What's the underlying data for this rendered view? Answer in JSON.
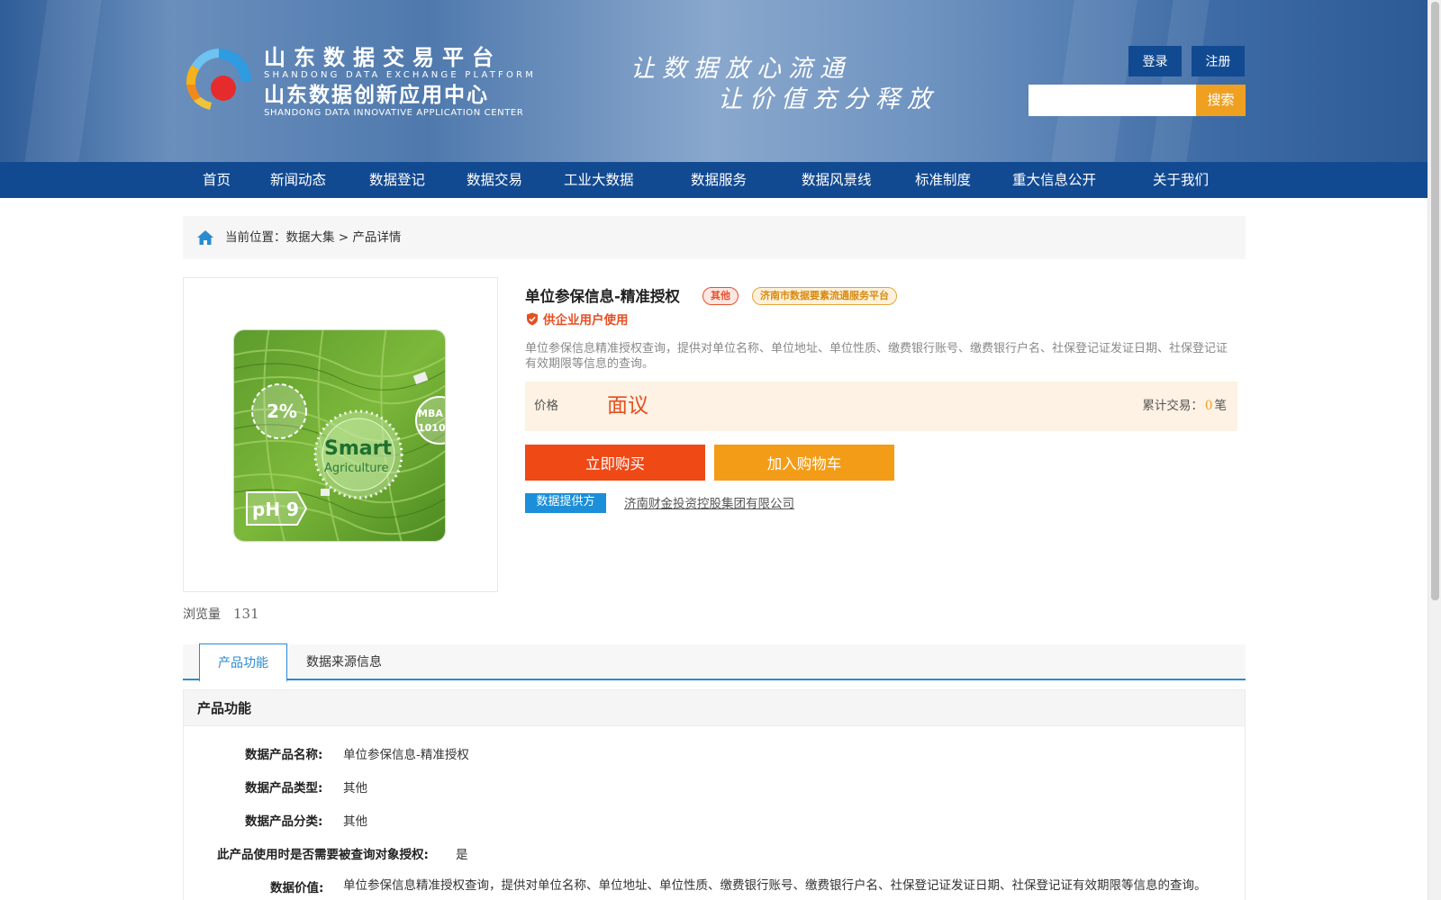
{
  "header": {
    "brand_cn1": "山东数据交易平台",
    "brand_en1": "SHANDONG DATA EXCHANGE PLATFORM",
    "brand_cn2": "山东数据创新应用中心",
    "brand_en2": "SHANDONG DATA INNOVATIVE APPLICATION CENTER",
    "slogan1": "让数据放心流通",
    "slogan2": "让价值充分释放",
    "login_label": "登录",
    "register_label": "注册",
    "search_placeholder": "",
    "search_label": "搜索"
  },
  "nav": {
    "items": [
      {
        "label": "首页"
      },
      {
        "label": "新闻动态"
      },
      {
        "label": "数据登记"
      },
      {
        "label": "数据交易"
      },
      {
        "label": "工业大数据"
      },
      {
        "label": "数据服务"
      },
      {
        "label": "数据风景线"
      },
      {
        "label": "标准制度"
      },
      {
        "label": "重大信息公开"
      },
      {
        "label": "关于我们"
      }
    ]
  },
  "breadcrumb": {
    "prefix": "当前位置：",
    "level1": "数据大集",
    "separator": " > ",
    "level2": "产品详情"
  },
  "product": {
    "title": "单位参保信息-精准授权",
    "tag_type": "其他",
    "tag_platform": "济南市数据要素流通服务平台",
    "enterprise_note": "供企业用户使用",
    "description": "单位参保信息精准授权查询，提供对单位名称、单位地址、单位性质、缴费银行账号、缴费银行户名、社保登记证发证日期、社保登记证有效期限等信息的查询。",
    "price_label": "价格",
    "price_value": "面议",
    "trade_label": "累计交易：",
    "trade_count": "0",
    "trade_unit": "笔",
    "buy_label": "立即购买",
    "cart_label": "加入购物车",
    "provider_badge": "数据提供方",
    "provider_name": "济南财金投资控股集团有限公司",
    "views_label": "浏览量",
    "views_count": "131",
    "image_text_pct": "2%",
    "image_text_smart": "Smart",
    "image_text_agri": "Agriculture",
    "image_text_ph": "pH 9",
    "image_text_mba": "MBA",
    "image_text_num": "1010"
  },
  "tabs": [
    {
      "label": "产品功能",
      "active": true
    },
    {
      "label": "数据来源信息",
      "active": false
    }
  ],
  "function_section": {
    "heading": "产品功能",
    "rows": [
      {
        "key": "数据产品名称:",
        "value": "单位参保信息-精准授权"
      },
      {
        "key": "数据产品类型:",
        "value": "其他"
      },
      {
        "key": "数据产品分类:",
        "value": "其他"
      },
      {
        "key": "此产品使用时是否需要被查询对象授权:",
        "value": "是"
      },
      {
        "key": "数据价值:",
        "value": "单位参保信息精准授权查询，提供对单位名称、单位地址、单位性质、缴费银行账号、缴费银行户名、社保登记证发证日期、社保登记证有效期限等信息的查询。"
      }
    ]
  },
  "colors": {
    "header_blue": "#124a92",
    "accent_orange": "#f39c17",
    "accent_red": "#ef4916",
    "link_blue": "#2a8bd0"
  }
}
